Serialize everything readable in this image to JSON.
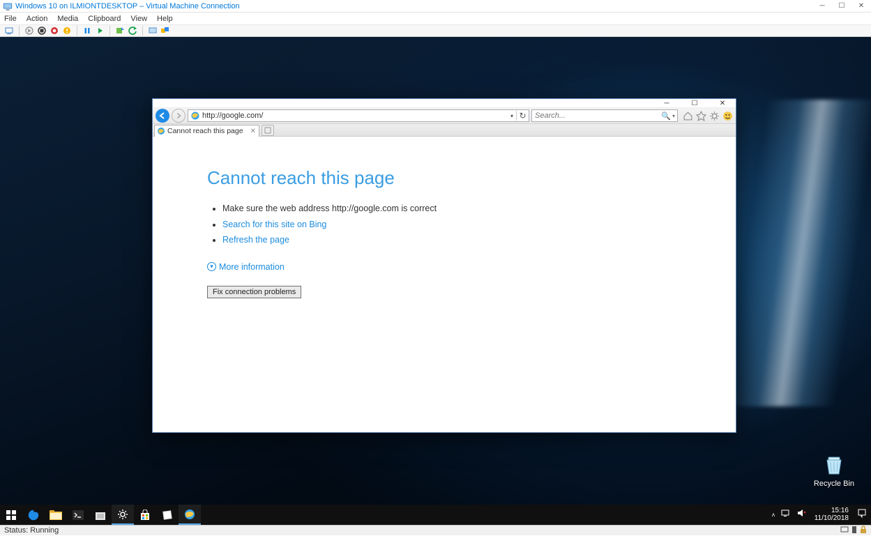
{
  "host": {
    "title": "Windows 10 on ILMIONTDESKTOP – Virtual Machine Connection",
    "menus": [
      "File",
      "Action",
      "Media",
      "Clipboard",
      "View",
      "Help"
    ],
    "status": "Status: Running"
  },
  "vm": {
    "recycle_label": "Recycle Bin",
    "time": "15:16",
    "date": "11/10/2018"
  },
  "ie": {
    "url": "http://google.com/",
    "search_placeholder": "Search...",
    "tab_title": "Cannot reach this page",
    "error": {
      "heading": "Cannot reach this page",
      "line1": "Make sure the web address http://google.com is correct",
      "link_bing": "Search for this site on Bing",
      "link_refresh": "Refresh the page",
      "more_info": "More information",
      "fix_button": "Fix connection problems"
    }
  }
}
